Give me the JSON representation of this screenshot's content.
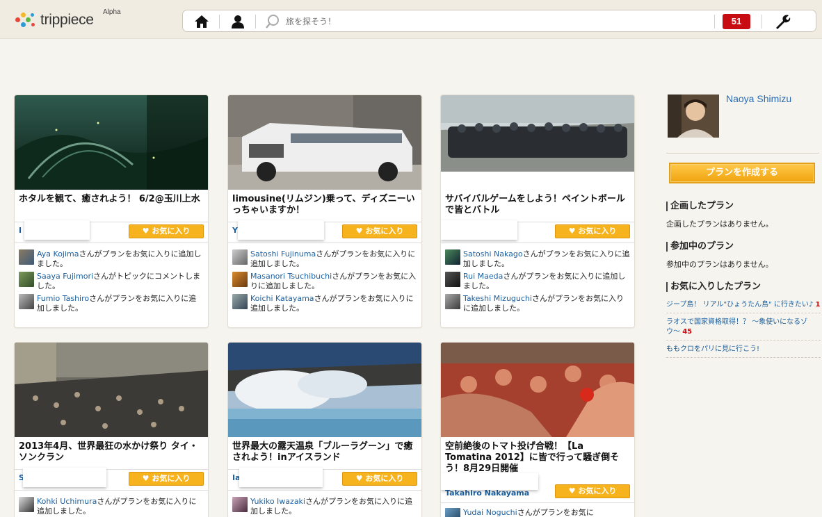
{
  "header": {
    "logo_text": "trippiece",
    "logo_badge": "Alpha",
    "search_placeholder": "旅を探そう！",
    "notification_count": "51"
  },
  "cards": [
    {
      "title": "ホタルを観て、癒されよう！ 6/2@玉川上水",
      "creator": "I",
      "fav_label": "お気に入り",
      "activities": [
        {
          "user": "Aya Kojima",
          "text": "さんがプランをお気に入りに追加しました。"
        },
        {
          "user": "Saaya Fujimori",
          "text": "さんがトピックにコメントしました。"
        },
        {
          "user": "Fumio Tashiro",
          "text": "さんがプランをお気に入りに追加しました。"
        }
      ]
    },
    {
      "title": "limousine(リムジン)乗って、ディズニーいっちゃいますか！",
      "creator": "Y",
      "fav_label": "お気に入り",
      "activities": [
        {
          "user": "Satoshi Fujinuma",
          "text": "さんがプランをお気に入りに追加しました。"
        },
        {
          "user": "Masanori Tsuchibuchi",
          "text": "さんがプランをお気に入りに追加しました。"
        },
        {
          "user": "Koichi Katayama",
          "text": "さんがプランをお気に入りに追加しました。"
        }
      ]
    },
    {
      "title": "サバイバルゲームをしよう！ペイントボールで皆とバトル",
      "creator": "",
      "fav_label": "お気に入り",
      "activities": [
        {
          "user": "Satoshi Nakago",
          "text": "さんがプランをお気に入りに追加しました。"
        },
        {
          "user": "Rui Maeda",
          "text": "さんがプランをお気に入りに追加しました。"
        },
        {
          "user": "Takeshi Mizuguchi",
          "text": "さんがプランをお気に入りに追加しました。"
        }
      ]
    },
    {
      "title": "2013年4月、世界最狂の水かけ祭り タイ・ソンクラン",
      "creator": "S",
      "fav_label": "お気に入り",
      "activities": [
        {
          "user": "Kohki Uchimura",
          "text": "さんがプランをお気に入りに追加しました。"
        }
      ]
    },
    {
      "title": "世界最大の露天温泉「ブルーラグーン」で癒されよう！inアイスランド",
      "creator": "Ia",
      "fav_label": "お気に入り",
      "activities": [
        {
          "user": "Yukiko Iwazaki",
          "text": "さんがプランをお気に入りに追加しました。"
        }
      ]
    },
    {
      "title": "空前絶後のトマト投げ合戦！【La Tomatina 2012】に皆で行って騒ぎ倒そう！8月29日開催",
      "creator": "Takahiro Nakayama",
      "fav_label": "お気に入り",
      "activities": [
        {
          "user": "Yudai Noguchi",
          "text": "さんがプランをお気に"
        }
      ]
    }
  ],
  "sidebar": {
    "user_name": "Naoya Shimizu",
    "create_button": "プランを作成する",
    "planned_heading": "企画したプラン",
    "planned_empty": "企画したプランはありません。",
    "joined_heading": "参加中のプラン",
    "joined_empty": "参加中のプランはありません。",
    "favorites_heading": "お気に入りしたプラン",
    "favorites": [
      {
        "label": "ジープ島！ リアル\"ひょうたん島\" に行きたい♪",
        "count": "1"
      },
      {
        "label": "ラオスで国家資格取得！？ 〜象使いになるゾウ〜",
        "count": "45"
      },
      {
        "label": "ももクロをパリに見に行こう!",
        "count": ""
      }
    ]
  },
  "colors": {
    "brand_blue": "#1a5fa0",
    "fav_orange": "#f7b31e",
    "badge_red": "#c80d12"
  }
}
